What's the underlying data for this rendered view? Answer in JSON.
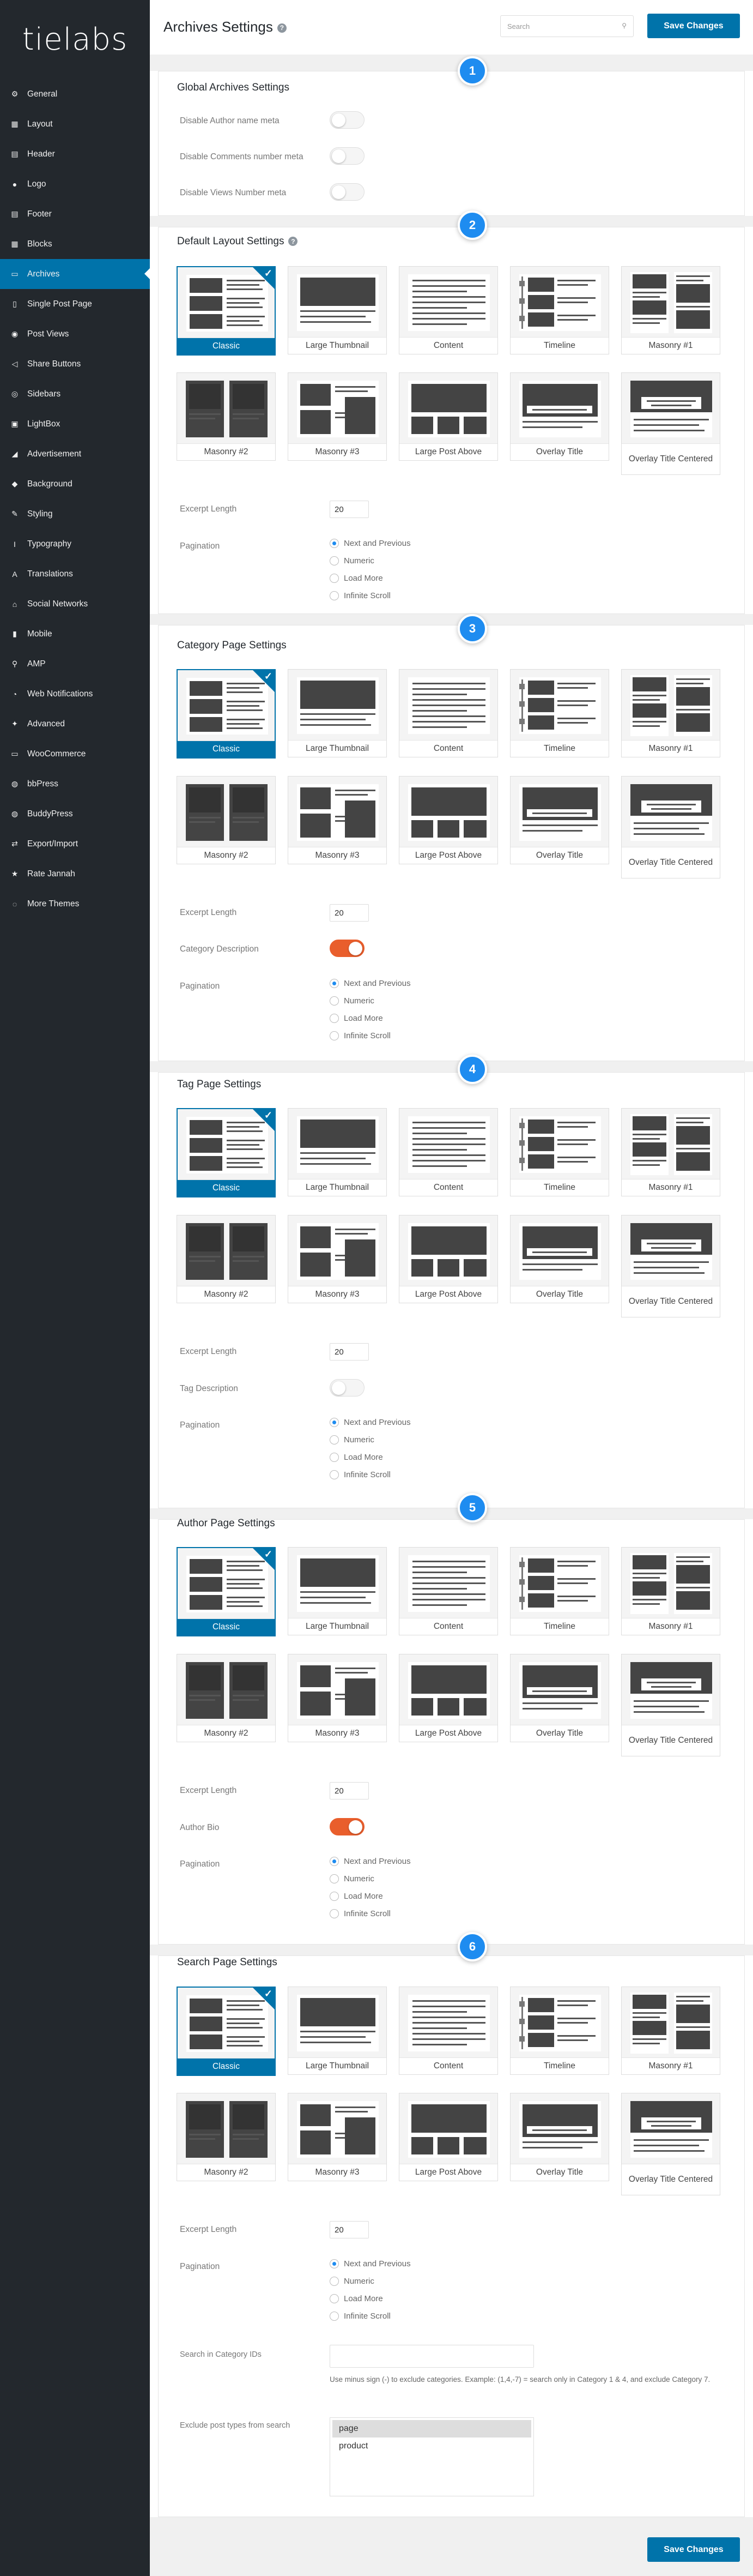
{
  "app": {
    "logo": "tielabs"
  },
  "sidebar": {
    "items": [
      {
        "label": "General",
        "icon": "gear-icon",
        "glyph": "⚙"
      },
      {
        "label": "Layout",
        "icon": "layout-icon",
        "glyph": "▦"
      },
      {
        "label": "Header",
        "icon": "header-icon",
        "glyph": "▤"
      },
      {
        "label": "Logo",
        "icon": "bulb-icon",
        "glyph": "●"
      },
      {
        "label": "Footer",
        "icon": "footer-icon",
        "glyph": "▤"
      },
      {
        "label": "Blocks",
        "icon": "blocks-icon",
        "glyph": "▦"
      },
      {
        "label": "Archives",
        "icon": "archives-icon",
        "glyph": "▭"
      },
      {
        "label": "Single Post Page",
        "icon": "page-icon",
        "glyph": "▯"
      },
      {
        "label": "Post Views",
        "icon": "eye-icon",
        "glyph": "◉"
      },
      {
        "label": "Share Buttons",
        "icon": "share-icon",
        "glyph": "◁"
      },
      {
        "label": "Sidebars",
        "icon": "sidebars-icon",
        "glyph": "◎"
      },
      {
        "label": "LightBox",
        "icon": "lightbox-icon",
        "glyph": "▣"
      },
      {
        "label": "Advertisement",
        "icon": "megaphone-icon",
        "glyph": "◢"
      },
      {
        "label": "Background",
        "icon": "paint-icon",
        "glyph": "◆"
      },
      {
        "label": "Styling",
        "icon": "brush-icon",
        "glyph": "✎"
      },
      {
        "label": "Typography",
        "icon": "italic-icon",
        "glyph": "I"
      },
      {
        "label": "Translations",
        "icon": "translate-icon",
        "glyph": "A"
      },
      {
        "label": "Social Networks",
        "icon": "network-icon",
        "glyph": "⌂"
      },
      {
        "label": "Mobile",
        "icon": "mobile-icon",
        "glyph": "▮"
      },
      {
        "label": "AMP",
        "icon": "amp-icon",
        "glyph": "⚲"
      },
      {
        "label": "Web Notifications",
        "icon": "bell-icon",
        "glyph": "◔"
      },
      {
        "label": "Advanced",
        "icon": "wrench-icon",
        "glyph": "✦"
      },
      {
        "label": "WooCommerce",
        "icon": "woo-icon",
        "glyph": "▭"
      },
      {
        "label": "bbPress",
        "icon": "bbpress-icon",
        "glyph": "◍"
      },
      {
        "label": "BuddyPress",
        "icon": "buddypress-icon",
        "glyph": "◍"
      },
      {
        "label": "Export/Import",
        "icon": "export-icon",
        "glyph": "⇄"
      },
      {
        "label": "Rate Jannah",
        "icon": "star-icon",
        "glyph": "★"
      },
      {
        "label": "More Themes",
        "icon": "themes-icon",
        "glyph": "◌"
      }
    ]
  },
  "header": {
    "title": "Archives Settings",
    "search_placeholder": "Search",
    "save_label": "Save Changes"
  },
  "layouts": [
    {
      "label": "Classic",
      "icon": "classic-layout-icon"
    },
    {
      "label": "Large Thumbnail",
      "icon": "large-thumbnail-layout-icon"
    },
    {
      "label": "Content",
      "icon": "content-layout-icon"
    },
    {
      "label": "Timeline",
      "icon": "timeline-layout-icon"
    },
    {
      "label": "Masonry #1",
      "icon": "masonry-1-layout-icon"
    },
    {
      "label": "Masonry #2",
      "icon": "masonry-2-layout-icon"
    },
    {
      "label": "Masonry #3",
      "icon": "masonry-3-layout-icon"
    },
    {
      "label": "Large Post Above",
      "icon": "large-post-above-layout-icon"
    },
    {
      "label": "Overlay Title",
      "icon": "overlay-title-layout-icon"
    },
    {
      "label": "Overlay Title Centered",
      "icon": "overlay-title-centered-layout-icon"
    }
  ],
  "selected_layout": "Classic",
  "pagination_options": [
    "Next and Previous",
    "Numeric",
    "Load More",
    "Infinite Scroll"
  ],
  "selected_pagination": "Next and Previous",
  "sections": {
    "global": {
      "number": "1",
      "title": "Global Archives Settings",
      "toggles": [
        {
          "label": "Disable Author name meta",
          "on": false
        },
        {
          "label": "Disable Comments number meta",
          "on": false
        },
        {
          "label": "Disable Views Number meta",
          "on": false
        }
      ]
    },
    "default": {
      "number": "2",
      "title": "Default Layout Settings",
      "excerpt_label": "Excerpt Length",
      "excerpt_value": "20",
      "pagination_label": "Pagination"
    },
    "category": {
      "number": "3",
      "title": "Category Page Settings",
      "excerpt_label": "Excerpt Length",
      "excerpt_value": "20",
      "desc_label": "Category Description",
      "desc_on": true,
      "pagination_label": "Pagination"
    },
    "tag": {
      "number": "4",
      "title": "Tag Page Settings",
      "excerpt_label": "Excerpt Length",
      "excerpt_value": "20",
      "desc_label": "Tag Description",
      "desc_on": false,
      "pagination_label": "Pagination"
    },
    "author": {
      "number": "5",
      "title": "Author Page Settings",
      "excerpt_label": "Excerpt Length",
      "excerpt_value": "20",
      "desc_label": "Author Bio",
      "desc_on": true,
      "pagination_label": "Pagination"
    },
    "search": {
      "number": "6",
      "title": "Search Page Settings",
      "excerpt_label": "Excerpt Length",
      "excerpt_value": "20",
      "pagination_label": "Pagination",
      "cat_ids_label": "Search in Category IDs",
      "cat_ids_value": "",
      "cat_ids_note": "Use minus sign (-) to exclude categories. Example: (1,4,-7) = search only in Category 1 & 4, and exclude Category 7.",
      "exclude_label": "Exclude post types from search",
      "post_types": [
        "page",
        "product"
      ],
      "post_types_selected": "page"
    }
  },
  "colors": {
    "accent": "#0073aa",
    "badge": "#1e8cf0",
    "toggle_on": "#e95e2c",
    "sidebar_bg": "#23282d"
  }
}
